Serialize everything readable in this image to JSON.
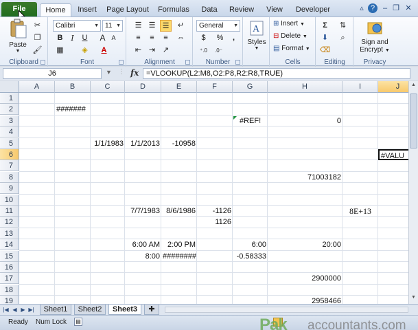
{
  "tabs": {
    "file": "File",
    "items": [
      "Home",
      "Insert",
      "Page Layout",
      "Formulas",
      "Data",
      "Review",
      "View",
      "Developer"
    ]
  },
  "ribbon": {
    "clipboard": {
      "label": "Clipboard",
      "paste": "Paste"
    },
    "font": {
      "label": "Font",
      "name": "Calibri",
      "size": "11",
      "bold": "B",
      "italic": "I",
      "underline": "U",
      "grow": "A",
      "shrink": "A",
      "color_glyph": "A"
    },
    "alignment": {
      "label": "Alignment"
    },
    "number": {
      "label": "Number",
      "format": "General",
      "currency": "$",
      "percent": "%",
      "comma": ","
    },
    "styles": {
      "label": "Styles"
    },
    "cells": {
      "label": "Cells",
      "insert": "Insert",
      "delete": "Delete",
      "format": "Format"
    },
    "editing": {
      "label": "Editing",
      "sum": "Σ"
    },
    "privacy": {
      "label": "Privacy",
      "sign": "Sign and",
      "encrypt": "Encrypt"
    }
  },
  "formula_bar": {
    "name_box": "J6",
    "fx": "fx",
    "formula": "=VLOOKUP(L2:M8,O2:P8,R2:R8,TRUE)"
  },
  "grid": {
    "columns": [
      "A",
      "B",
      "C",
      "D",
      "E",
      "F",
      "G",
      "H",
      "I",
      "J"
    ],
    "rows": [
      "1",
      "2",
      "3",
      "4",
      "5",
      "6",
      "7",
      "8",
      "9",
      "10",
      "11",
      "12",
      "13",
      "14",
      "15",
      "16",
      "17",
      "18",
      "19"
    ],
    "cells": {
      "B2": "#######",
      "G3": "#REF!",
      "H3": "0",
      "C5": "1/1/1983",
      "D5": "1/1/2013",
      "E5": "-10958",
      "J6": "#VALU",
      "H8": "71003182",
      "D11": "7/7/1983",
      "E11": "8/6/1986",
      "F11": "-1126",
      "I11": "8E+13",
      "F12": "1126",
      "D14": "6:00 AM",
      "E14": "2:00 PM",
      "G14": "6:00",
      "H14": "20:00",
      "D15": "8:00",
      "E15": "########",
      "G15": "-0.58333",
      "H17": "2900000",
      "H19": "2958466"
    }
  },
  "sheets": [
    "Sheet1",
    "Sheet2",
    "Sheet3"
  ],
  "active_sheet": "Sheet3",
  "status": {
    "ready": "Ready",
    "num_lock": "Num Lock"
  },
  "watermark": {
    "brand": "Pak",
    "rest": "accountants.com"
  },
  "colors": {
    "file_tab": "#1f6c1f",
    "accent": "#2b579a",
    "selection": "#f8c96c"
  }
}
